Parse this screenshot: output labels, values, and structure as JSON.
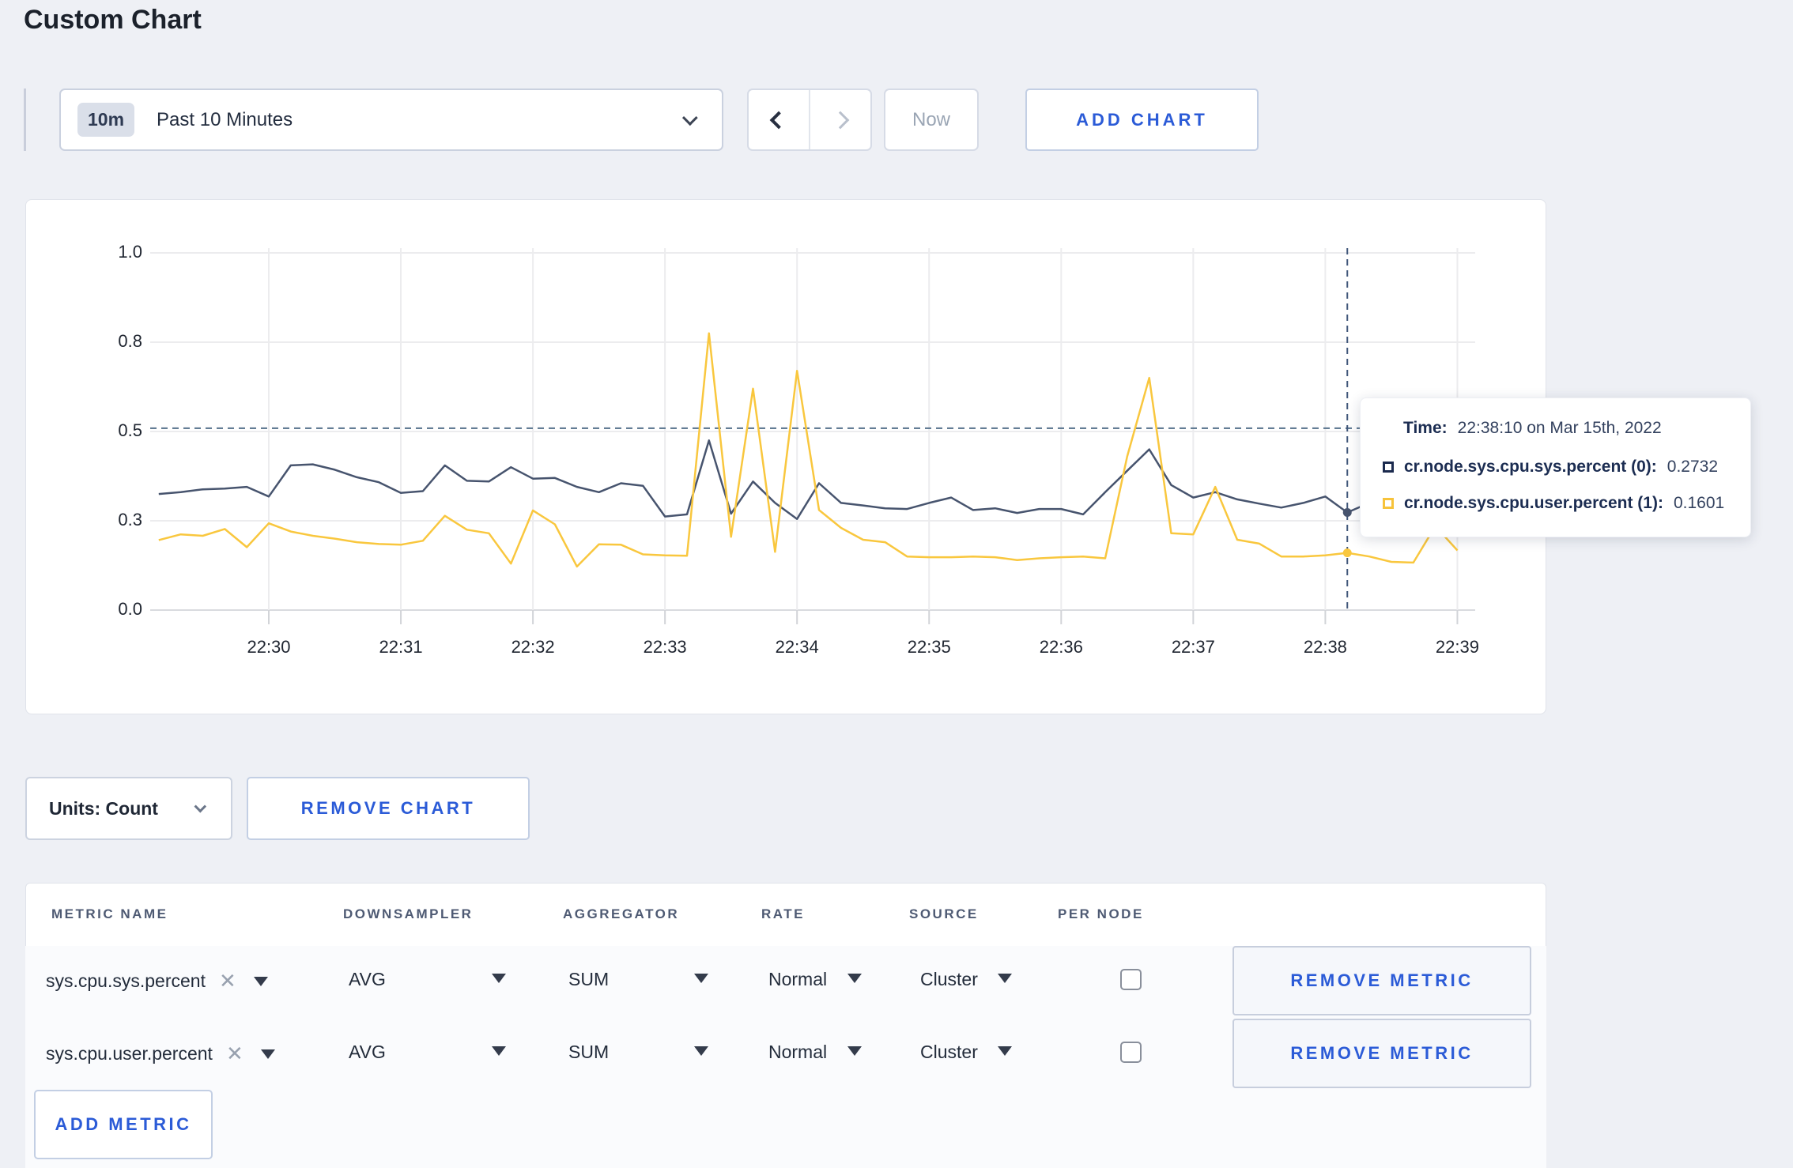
{
  "page": {
    "title": "Custom Chart"
  },
  "toolbar": {
    "range_badge": "10m",
    "range_label": "Past 10 Minutes",
    "now_label": "Now",
    "add_chart_label": "ADD CHART"
  },
  "chart": {
    "tooltip": {
      "time_label": "Time:",
      "time_value": "22:38:10 on Mar 15th, 2022",
      "series": [
        {
          "label": "cr.node.sys.cpu.sys.percent (0):",
          "value": "0.2732",
          "swatch_color": "#1b2a4e"
        },
        {
          "label": "cr.node.sys.cpu.user.percent (1):",
          "value": "0.1601",
          "swatch_color": "#f7c33b"
        }
      ]
    }
  },
  "chart_data": {
    "type": "line",
    "title": "",
    "xlabel": "",
    "ylabel": "",
    "x_start_time": "22:29:10",
    "x_interval_seconds": 10,
    "x_tick_labels": [
      "22:30",
      "22:31",
      "22:32",
      "22:33",
      "22:34",
      "22:35",
      "22:36",
      "22:37",
      "22:38",
      "22:39"
    ],
    "y_tick_labels": [
      "1.0",
      "0.8",
      "0.5",
      "0.3",
      "0.0"
    ],
    "y_tick_values": [
      1.0,
      0.75,
      0.5,
      0.25,
      0.0
    ],
    "ylim": [
      0,
      1
    ],
    "grid": true,
    "legend_position": "tooltip",
    "series": [
      {
        "name": "cr.node.sys.cpu.sys.percent",
        "color": "#47546e",
        "values": [
          0.325,
          0.33,
          0.338,
          0.34,
          0.345,
          0.318,
          0.405,
          0.408,
          0.393,
          0.372,
          0.358,
          0.328,
          0.333,
          0.405,
          0.362,
          0.36,
          0.4,
          0.368,
          0.37,
          0.345,
          0.33,
          0.355,
          0.348,
          0.262,
          0.268,
          0.475,
          0.27,
          0.36,
          0.3,
          0.255,
          0.355,
          0.3,
          0.293,
          0.285,
          0.283,
          0.3,
          0.315,
          0.28,
          0.285,
          0.272,
          0.283,
          0.283,
          0.268,
          0.33,
          0.39,
          0.45,
          0.35,
          0.315,
          0.33,
          0.31,
          0.298,
          0.287,
          0.3,
          0.318,
          0.2732,
          0.3,
          0.295,
          0.3,
          0.31,
          0.3
        ]
      },
      {
        "name": "cr.node.sys.cpu.user.percent",
        "color": "#f9c73e",
        "values": [
          0.196,
          0.212,
          0.208,
          0.227,
          0.176,
          0.243,
          0.22,
          0.208,
          0.2,
          0.19,
          0.185,
          0.183,
          0.194,
          0.264,
          0.225,
          0.215,
          0.13,
          0.279,
          0.24,
          0.122,
          0.184,
          0.183,
          0.156,
          0.153,
          0.152,
          0.775,
          0.205,
          0.62,
          0.163,
          0.67,
          0.28,
          0.23,
          0.197,
          0.19,
          0.15,
          0.148,
          0.148,
          0.15,
          0.148,
          0.14,
          0.145,
          0.148,
          0.15,
          0.145,
          0.43,
          0.65,
          0.215,
          0.212,
          0.345,
          0.197,
          0.186,
          0.15,
          0.15,
          0.153,
          0.1601,
          0.15,
          0.135,
          0.133,
          0.235,
          0.167
        ]
      }
    ],
    "hover": {
      "time": "22:38:10",
      "x_index": 54,
      "crosshair_y_value": 0.509,
      "point_values": [
        0.2732,
        0.1601
      ]
    }
  },
  "units_row": {
    "units_label": "Units: Count",
    "remove_chart_label": "REMOVE CHART"
  },
  "metrics_table": {
    "headers": [
      "METRIC NAME",
      "DOWNSAMPLER",
      "AGGREGATOR",
      "RATE",
      "SOURCE",
      "PER NODE"
    ],
    "rows": [
      {
        "metric": "sys.cpu.sys.percent",
        "downsampler": "AVG",
        "aggregator": "SUM",
        "rate": "Normal",
        "source": "Cluster",
        "per_node_checked": false,
        "remove_label": "REMOVE METRIC"
      },
      {
        "metric": "sys.cpu.user.percent",
        "downsampler": "AVG",
        "aggregator": "SUM",
        "rate": "Normal",
        "source": "Cluster",
        "per_node_checked": false,
        "remove_label": "REMOVE METRIC"
      }
    ],
    "add_metric_label": "ADD METRIC"
  }
}
